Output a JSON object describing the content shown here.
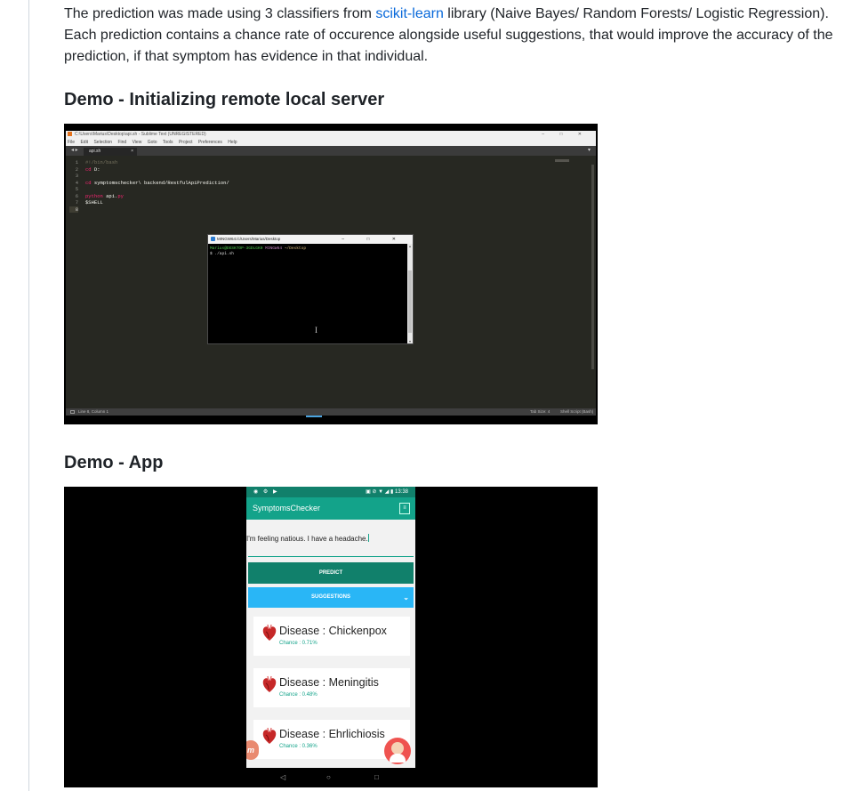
{
  "intro": {
    "text_before": "The prediction was made using 3 classifiers from ",
    "link": "scikit-learn",
    "text_after": " library (Naive Bayes/ Random Forests/ Logistic Regression). Each prediction contains a chance rate of occurence alongside useful suggestions, that would improve the accuracy of the prediction, if that symptom has evidence in that individual."
  },
  "headings": {
    "server": "Demo - Initializing remote local server",
    "app": "Demo - App"
  },
  "editor": {
    "title": "C:\\Users\\Marius\\Desktop\\api.sh - Sublime Text (UNREGISTERED)",
    "window_controls": "– □ ✕",
    "menu": [
      "File",
      "Edit",
      "Selection",
      "Find",
      "View",
      "Goto",
      "Tools",
      "Project",
      "Preferences",
      "Help"
    ],
    "tab_arrows": "◂ ▸",
    "tab": "api.sh",
    "tab_close": "×",
    "dropdown": "▾",
    "line_numbers": [
      "1",
      "2",
      "3",
      "4",
      "5",
      "6",
      "7",
      "8"
    ],
    "code": {
      "l1": "#!/bin/bash",
      "l2_kw": "cd",
      "l2_rest": " D:",
      "l4_kw": "cd",
      "l4_rest": " symptomschecker\\ backend/RestfulApiPrediction/",
      "l6_kw": "python",
      "l6_rest": " api.",
      "l6_ext": "py",
      "l7": "$SHELL"
    },
    "status_left": "Line 8, Column 1",
    "status_tab": "Tab Size: 4",
    "status_syntax": "Shell Script (Bash)"
  },
  "terminal": {
    "title": "MINGW64:/c/Users/Marius/Desktop",
    "controls": "– □ ✕",
    "prompt_user": "Marius@DESKTOP-3GDLGK0",
    "prompt_env": "MINGW64",
    "prompt_path": "~/Desktop",
    "command": "$ ./api.sh",
    "scroll_up": "▴",
    "scroll_down": "▾",
    "cursor": "I"
  },
  "app": {
    "status_icons_left": "◉ ⚙ ▶",
    "status_icons_right": "▣ ⊘ ▼ ◢ ▮ 13:38",
    "title": "SymptomsChecker",
    "action_icon": "≡",
    "input_text": "I'm feeling natious. I have a headache.",
    "predict_label": "PREDICT",
    "suggestions_label": "SUGGESTIONS",
    "chevron": "⌄",
    "results": [
      {
        "disease": "Disease : Chickenpox",
        "chance": "Chance : 0.71%"
      },
      {
        "disease": "Disease : Meningitis",
        "chance": "Chance : 0.48%"
      },
      {
        "disease": "Disease : Ehrlichiosis",
        "chance": "Chance : 0.36%"
      }
    ],
    "nav": {
      "back": "◁",
      "home": "○",
      "recents": "□"
    },
    "fab_left_letter": "m",
    "colors": {
      "primary": "#13a38a",
      "primary_dark": "#11806b",
      "accent": "#29b6f6",
      "fab": "#ef5350"
    }
  }
}
